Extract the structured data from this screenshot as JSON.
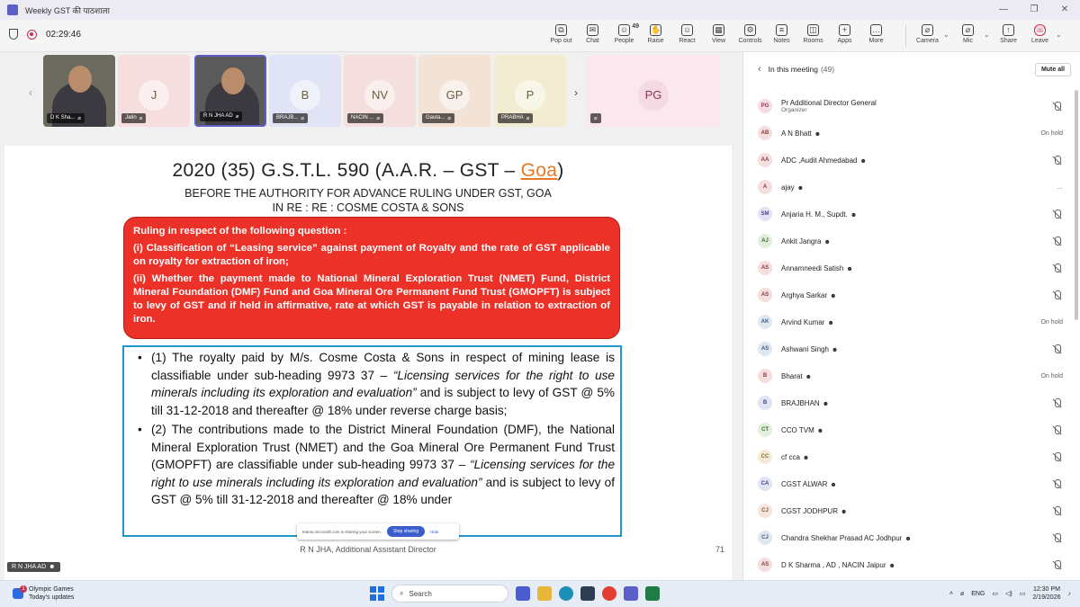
{
  "window": {
    "title": "Weekly GST की पाठशाला"
  },
  "meeting": {
    "timer": "02:29:46"
  },
  "toolbar": [
    {
      "name": "popout",
      "label": "Pop out",
      "glyph": "⧉"
    },
    {
      "name": "chat",
      "label": "Chat",
      "glyph": "✉"
    },
    {
      "name": "people",
      "label": "People",
      "glyph": "☺",
      "count": "49"
    },
    {
      "name": "raise",
      "label": "Raise",
      "glyph": "✋"
    },
    {
      "name": "react",
      "label": "React",
      "glyph": "☺"
    },
    {
      "name": "view",
      "label": "View",
      "glyph": "▦"
    },
    {
      "name": "controls",
      "label": "Controls",
      "glyph": "⚙"
    },
    {
      "name": "notes",
      "label": "Notes",
      "glyph": "≡"
    },
    {
      "name": "rooms",
      "label": "Rooms",
      "glyph": "◫"
    },
    {
      "name": "apps",
      "label": "Apps",
      "glyph": "+"
    },
    {
      "name": "more",
      "label": "More",
      "glyph": "…"
    }
  ],
  "toolbar_right": {
    "camera": "Camera",
    "mic": "Mic",
    "share": "Share",
    "leave": "Leave"
  },
  "tiles": [
    {
      "name": "D K Sha...",
      "initials": "",
      "video": true,
      "color": "#6c6a5f"
    },
    {
      "name": "Jatin",
      "initials": "J",
      "video": false,
      "color": "#f7dede"
    },
    {
      "name": "R N JHA AD",
      "initials": "",
      "video": true,
      "color": "#5a5a5a"
    },
    {
      "name": "BRAJB...",
      "initials": "B",
      "video": false,
      "color": "#e0e4f4"
    },
    {
      "name": "NACIN ...",
      "initials": "NV",
      "video": false,
      "color": "#f4dede"
    },
    {
      "name": "Gauta...",
      "initials": "GP",
      "video": false,
      "color": "#f3e2d6"
    },
    {
      "name": "PRABHA",
      "initials": "P",
      "video": false,
      "color": "#f1ecd2"
    }
  ],
  "overflow_tile": {
    "initials": "PG"
  },
  "slide": {
    "title_pre": "2020 (35) G.S.T.L. 590 (A.A.R. – GST – ",
    "title_goa": "Goa",
    "title_post": ")",
    "subtitle1": "BEFORE THE  AUTHORITY FOR ADVANCE RULING UNDER GST, GOA",
    "subtitle2": "IN RE : RE : COSME COSTA & SONS",
    "red_heading": "Ruling in respect of the following question :",
    "red_q1": "(i)        Classification of “Leasing service” against payment of Royalty and the rate of GST applicable on royalty for extraction of iron;",
    "red_q2": "(ii)        Whether the payment made to National Mineral Exploration Trust (NMET) Fund, District Mineral Foundation (DMF) Fund and Goa Mineral Ore Permanent Fund Trust (GMOPFT) is subject to levy of GST and if held in affirmative, rate at which GST is payable in relation to extraction of iron.",
    "p1_a": "(1)    The royalty paid by M/s. Cosme Costa & Sons in respect of mining lease is classifiable under sub-heading 9973 37 – ",
    "p1_i": "“Licensing services for the right to use minerals including its exploration and evaluation”",
    "p1_b": " and is subject to levy of GST @ 5% till 31-12-2018 and thereafter @ 18% under reverse charge basis;",
    "p2_a": "(2)    The contributions made to the District Mineral Foundation (DMF), the National Mineral Exploration Trust (NMET) and the Goa Mineral Ore Permanent Fund Trust (GMOPFT) are classifiable under sub-heading 9973 37 ",
    "p2_i": "– “Licensing services for the right to use minerals including its exploration and evaluation”",
    "p2_b": " and is subject to levy of GST @ 5% till 31-12-2018 and thereafter @ 18% under",
    "footer": "R N JHA, Additional Assistant Director",
    "page": "71"
  },
  "share_bar": {
    "text": "teams.microsoft.com is sharing your screen.",
    "stop": "Stop sharing",
    "hide": "Hide"
  },
  "presenter": "R N JHA AD",
  "panel": {
    "title": "In this meeting",
    "count": "(49)",
    "mute_all": "Mute all",
    "participants": [
      {
        "initials": "PG",
        "name": "Pr Additional Director General",
        "sub": "Organizer",
        "status": "",
        "muted": true,
        "color": "#f4dde3",
        "tcolor": "#8a3b52"
      },
      {
        "initials": "AB",
        "name": "A N Bhatt",
        "sub": "",
        "status": "On hold",
        "muted": false,
        "color": "#f4dede",
        "tcolor": "#8a3b3b"
      },
      {
        "initials": "AA",
        "name": "ADC ,Audit Ahmedabad",
        "sub": "",
        "status": "",
        "muted": true,
        "color": "#f4dede",
        "tcolor": "#8a3b3b"
      },
      {
        "initials": "A",
        "name": "ajay",
        "sub": "",
        "status": "…",
        "muted": false,
        "color": "#f4dede",
        "tcolor": "#8a3b3b"
      },
      {
        "initials": "SM",
        "name": "Anjaria H. M., Supdt.",
        "sub": "",
        "status": "",
        "muted": true,
        "color": "#e4e2f4",
        "tcolor": "#4b4a8a"
      },
      {
        "initials": "AJ",
        "name": "Ankit Jangra",
        "sub": "",
        "status": "",
        "muted": true,
        "color": "#e2efdd",
        "tcolor": "#3b6b2e"
      },
      {
        "initials": "AS",
        "name": "Annamneedi Satish",
        "sub": "",
        "status": "",
        "muted": true,
        "color": "#f4dede",
        "tcolor": "#8a3b3b"
      },
      {
        "initials": "AS",
        "name": "Arghya Sarkar",
        "sub": "",
        "status": "",
        "muted": true,
        "color": "#f4dede",
        "tcolor": "#8a3b3b"
      },
      {
        "initials": "AK",
        "name": "Arvind Kumar",
        "sub": "",
        "status": "On hold",
        "muted": false,
        "color": "#dfe8f0",
        "tcolor": "#3b5a7a"
      },
      {
        "initials": "AS",
        "name": "Ashwani Singh",
        "sub": "",
        "status": "",
        "muted": true,
        "color": "#dfe8f0",
        "tcolor": "#3b5a7a"
      },
      {
        "initials": "B",
        "name": "Bharat",
        "sub": "",
        "status": "On hold",
        "muted": false,
        "color": "#f4dede",
        "tcolor": "#8a3b3b"
      },
      {
        "initials": "B",
        "name": "BRAJBHAN",
        "sub": "",
        "status": "",
        "muted": true,
        "color": "#e2e4f4",
        "tcolor": "#3b4a8a"
      },
      {
        "initials": "CT",
        "name": "CCO TVM",
        "sub": "",
        "status": "",
        "muted": true,
        "color": "#e2efdd",
        "tcolor": "#3b6b2e"
      },
      {
        "initials": "CC",
        "name": "cf cca",
        "sub": "",
        "status": "",
        "muted": true,
        "color": "#f4ecd6",
        "tcolor": "#8a6a2e"
      },
      {
        "initials": "CA",
        "name": "CGST ALWAR",
        "sub": "",
        "status": "",
        "muted": true,
        "color": "#e2e4f4",
        "tcolor": "#3b4a8a"
      },
      {
        "initials": "CJ",
        "name": "CGST JODHPUR",
        "sub": "",
        "status": "",
        "muted": true,
        "color": "#f4e6dc",
        "tcolor": "#8a4f2e"
      },
      {
        "initials": "CJ",
        "name": "Chandra Shekhar Prasad AC Jodhpur",
        "sub": "",
        "status": "",
        "muted": true,
        "color": "#dfe8f0",
        "tcolor": "#3b5a7a"
      },
      {
        "initials": "AS",
        "name": "D K Sharma , AD , NACIN Jaipur",
        "sub": "",
        "status": "",
        "muted": true,
        "color": "#f4dede",
        "tcolor": "#8a3b3b"
      }
    ]
  },
  "taskbar": {
    "weather_title": "Olympic Games",
    "weather_sub": "Today's updates",
    "search": "Search",
    "lang": "ENG",
    "time": "12:30 PM",
    "date": "2/19/2026"
  }
}
